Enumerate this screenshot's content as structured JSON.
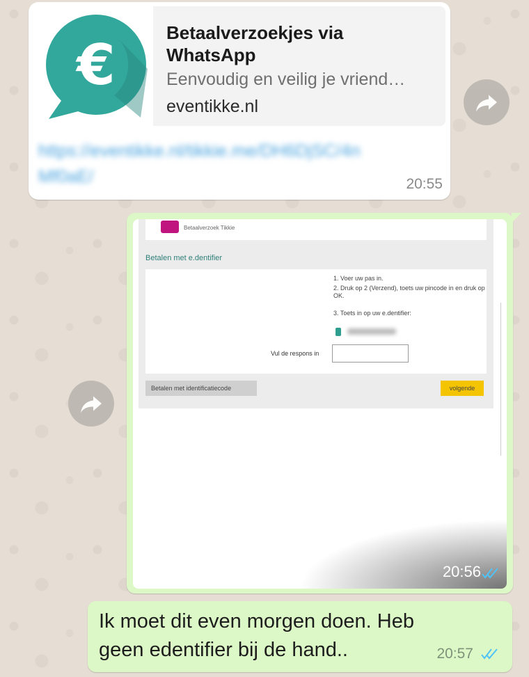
{
  "chat": {
    "link_message": {
      "preview_title": "Betaalverzoekjes via WhatsApp",
      "preview_description": "Eenvoudig en veilig je vriend…",
      "preview_domain": "eventikke.nl",
      "url_text": "https://eventikke.nl/tikkie.me/DH6DjSC/4nMf0aE/",
      "time": "20:55",
      "thumb_icon": "euro-speech-bubble-icon"
    },
    "image_message": {
      "time": "20:56",
      "status": "read",
      "screenshot": {
        "logo_caption": "Betaalverzoek Tikkie",
        "section_title": "Betalen met e.dentifier",
        "steps": [
          "1. Voer uw pas in.",
          "2. Druk op 2 (Verzend), toets uw pincode in en druk op OK.",
          "3. Toets in op uw e.dentifier:"
        ],
        "response_label": "Vul de respons in",
        "left_button": "Betalen met identificatiecode",
        "next_button": "volgende"
      }
    },
    "text_message": {
      "text": "Ik moet dit even morgen doen. Heb geen edentifier bij de hand..",
      "time": "20:57",
      "status": "read"
    }
  },
  "colors": {
    "outgoing_bubble": "#dcf8c6",
    "incoming_bubble": "#ffffff",
    "read_ticks": "#4fc3f7",
    "accent_teal": "#2a9d8f"
  }
}
